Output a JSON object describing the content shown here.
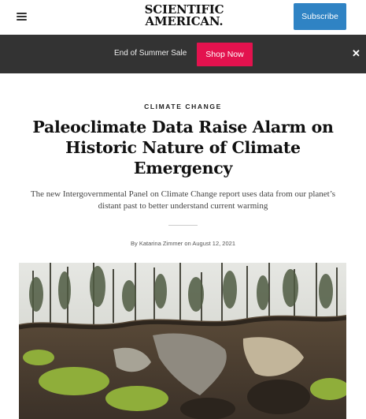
{
  "header": {
    "logo_line1": "SCIENTIFIC",
    "logo_line2": "AMERICAN.",
    "subscribe_label": "Subscribe",
    "menu_icon": "hamburger-menu-icon"
  },
  "promo": {
    "text": "End of Summer Sale",
    "button_label": "Shop Now",
    "close_label": "✕",
    "button_color": "#e3124e",
    "bar_color": "#333333"
  },
  "article": {
    "kicker": "CLIMATE CHANGE",
    "headline": "Paleoclimate Data Raise Alarm on Historic Nature of Climate Emergency",
    "dek": "The new Intergovernmental Panel on Climate Change report uses data from our planet’s distant past to better understand current warming",
    "byline_prefix": "By ",
    "author": "Katarina Zimmer",
    "byline_date": " on August 12, 2021"
  },
  "colors": {
    "accent": "#2f83c4"
  }
}
